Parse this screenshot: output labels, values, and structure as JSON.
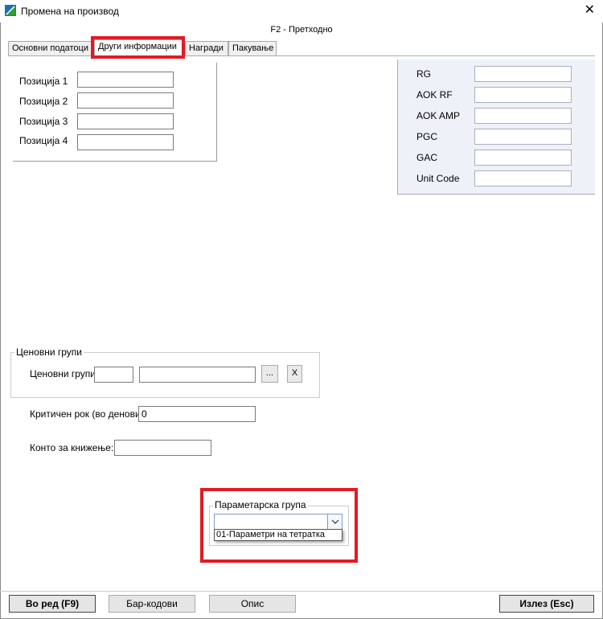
{
  "window": {
    "title": "Промена на производ",
    "close_glyph": "✕"
  },
  "hint": "F2 - Претходно",
  "tabs": [
    {
      "label": "Основни податоци",
      "active": false
    },
    {
      "label": "Други информации",
      "active": true
    },
    {
      "label": "Награди",
      "active": false
    },
    {
      "label": "Пакување",
      "active": false
    }
  ],
  "positions": {
    "fields": [
      {
        "label": "Позиција 1",
        "value": ""
      },
      {
        "label": "Позиција 2",
        "value": ""
      },
      {
        "label": "Позиција 3",
        "value": ""
      },
      {
        "label": "Позиција 4",
        "value": ""
      }
    ]
  },
  "codes": {
    "fields": [
      {
        "label": "RG",
        "value": ""
      },
      {
        "label": "AOK RF",
        "value": ""
      },
      {
        "label": "AOK AMP",
        "value": ""
      },
      {
        "label": "PGC",
        "value": ""
      },
      {
        "label": "GAC",
        "value": ""
      },
      {
        "label": "Unit Code",
        "value": ""
      }
    ]
  },
  "price_groups": {
    "title": "Ценовни групи",
    "label": "Ценовни групи:",
    "code_value": "",
    "name_value": "",
    "browse_label": "...",
    "clear_label": "X"
  },
  "critical_term": {
    "label": "Критичен рок (во денови):",
    "value": "0"
  },
  "posting_account": {
    "label": "Конто за книжење:",
    "value": ""
  },
  "parameter_group": {
    "title": "Параметарска група",
    "selected": "",
    "options": [
      "01-Параметри на тетратка"
    ]
  },
  "buttons": {
    "ok": "Во ред (F9)",
    "barcodes": "Бар-кодови",
    "description": "Опис",
    "exit": "Излез (Esc)"
  },
  "colors": {
    "highlight": "#e01b24",
    "code_panel_bg": "#eef2f8"
  }
}
